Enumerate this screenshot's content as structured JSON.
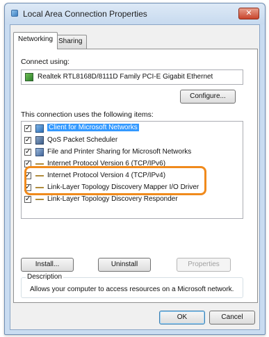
{
  "window": {
    "title": "Local Area Connection Properties",
    "close_label": "✕"
  },
  "tabs": [
    {
      "label": "Networking"
    },
    {
      "label": "Sharing"
    }
  ],
  "connect_using": {
    "label": "Connect using:",
    "adapter": "Realtek RTL8168D/8111D Family PCI-E Gigabit Ethernet"
  },
  "buttons": {
    "configure": "Configure...",
    "install": "Install...",
    "uninstall": "Uninstall",
    "properties": "Properties",
    "ok": "OK",
    "cancel": "Cancel"
  },
  "items_label": "This connection uses the following items:",
  "items": [
    {
      "label": "Client for Microsoft Networks",
      "checked": true,
      "icon": "network-client-icon"
    },
    {
      "label": "QoS Packet Scheduler",
      "checked": true,
      "icon": "qos-icon"
    },
    {
      "label": "File and Printer Sharing for Microsoft Networks",
      "checked": true,
      "icon": "file-printer-sharing-icon"
    },
    {
      "label": "Internet Protocol Version 6 (TCP/IPv6)",
      "checked": true,
      "icon": "protocol-icon"
    },
    {
      "label": "Internet Protocol Version 4 (TCP/IPv4)",
      "checked": true,
      "icon": "protocol-icon"
    },
    {
      "label": "Link-Layer Topology Discovery Mapper I/O Driver",
      "checked": true,
      "icon": "protocol-icon"
    },
    {
      "label": "Link-Layer Topology Discovery Responder",
      "checked": true,
      "icon": "protocol-icon"
    }
  ],
  "check_glyph": "✓",
  "description": {
    "legend": "Description",
    "text": "Allows your computer to access resources on a Microsoft network."
  },
  "colors": {
    "highlight": "#f08a1c",
    "selection": "#3399ff"
  }
}
